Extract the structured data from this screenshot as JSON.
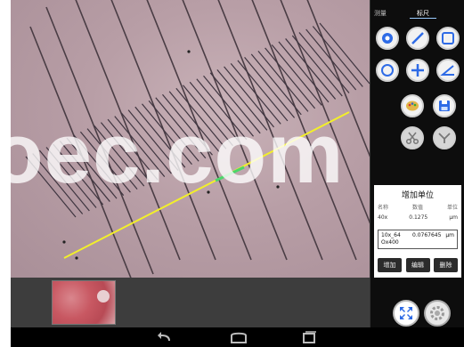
{
  "panel": {
    "tabs": [
      "测量",
      "标尺"
    ],
    "unit_title": "增加单位",
    "headers": [
      "名称",
      "数值",
      "单位"
    ],
    "row": [
      "40x",
      "0.1275",
      "μm"
    ],
    "entry": {
      "name_line1": "10x_64",
      "name_line2": "Ox400",
      "value": "0.0767645",
      "unit": "μm"
    },
    "buttons": [
      "增加",
      "编辑",
      "删除"
    ]
  },
  "watermark": "oec.com",
  "colors": {
    "measure_line": "#f2ef2a",
    "highlight_segment": "#4bd66a",
    "panel_bg": "#0d0d0d"
  },
  "icons": [
    "dot-tool-icon",
    "line-tool-icon",
    "rect-tool-icon",
    "circle-tool-icon",
    "cross-tool-icon",
    "angle-tool-icon",
    "palette-icon",
    "save-icon",
    "scissors-icon",
    "cut-icon"
  ]
}
